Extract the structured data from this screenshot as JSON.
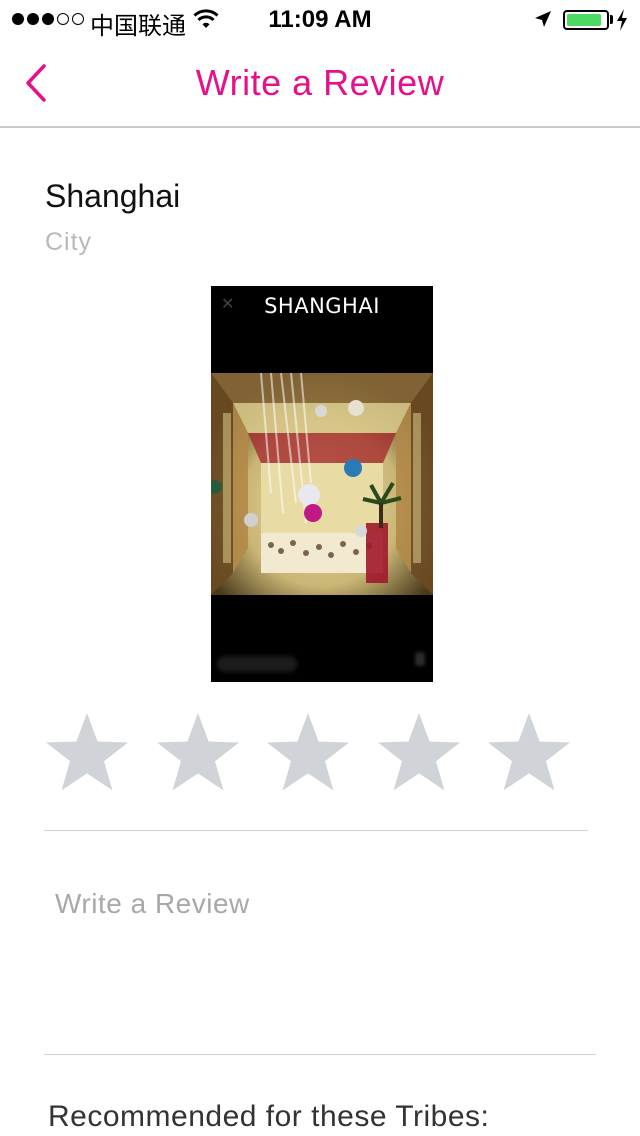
{
  "status_bar": {
    "carrier": "中国联通",
    "time": "11:09 AM",
    "signal_bars_filled": 3,
    "signal_bars_total": 5,
    "battery_level": 0.9,
    "battery_color": "#4cd964",
    "icons": [
      "wifi-icon",
      "location-arrow-icon",
      "battery-icon",
      "charging-icon"
    ]
  },
  "nav": {
    "title": "Write a Review",
    "back_icon": "chevron-left-icon",
    "accent_color": "#e6118a"
  },
  "place": {
    "name": "Shanghai",
    "type": "City"
  },
  "photo": {
    "caption": "SHANGHAI"
  },
  "rating": {
    "max": 5,
    "value": 0,
    "star_color_empty": "#d0d4d8"
  },
  "review": {
    "placeholder": "Write a Review",
    "value": ""
  },
  "tribes": {
    "heading": "Recommended for these Tribes:"
  }
}
